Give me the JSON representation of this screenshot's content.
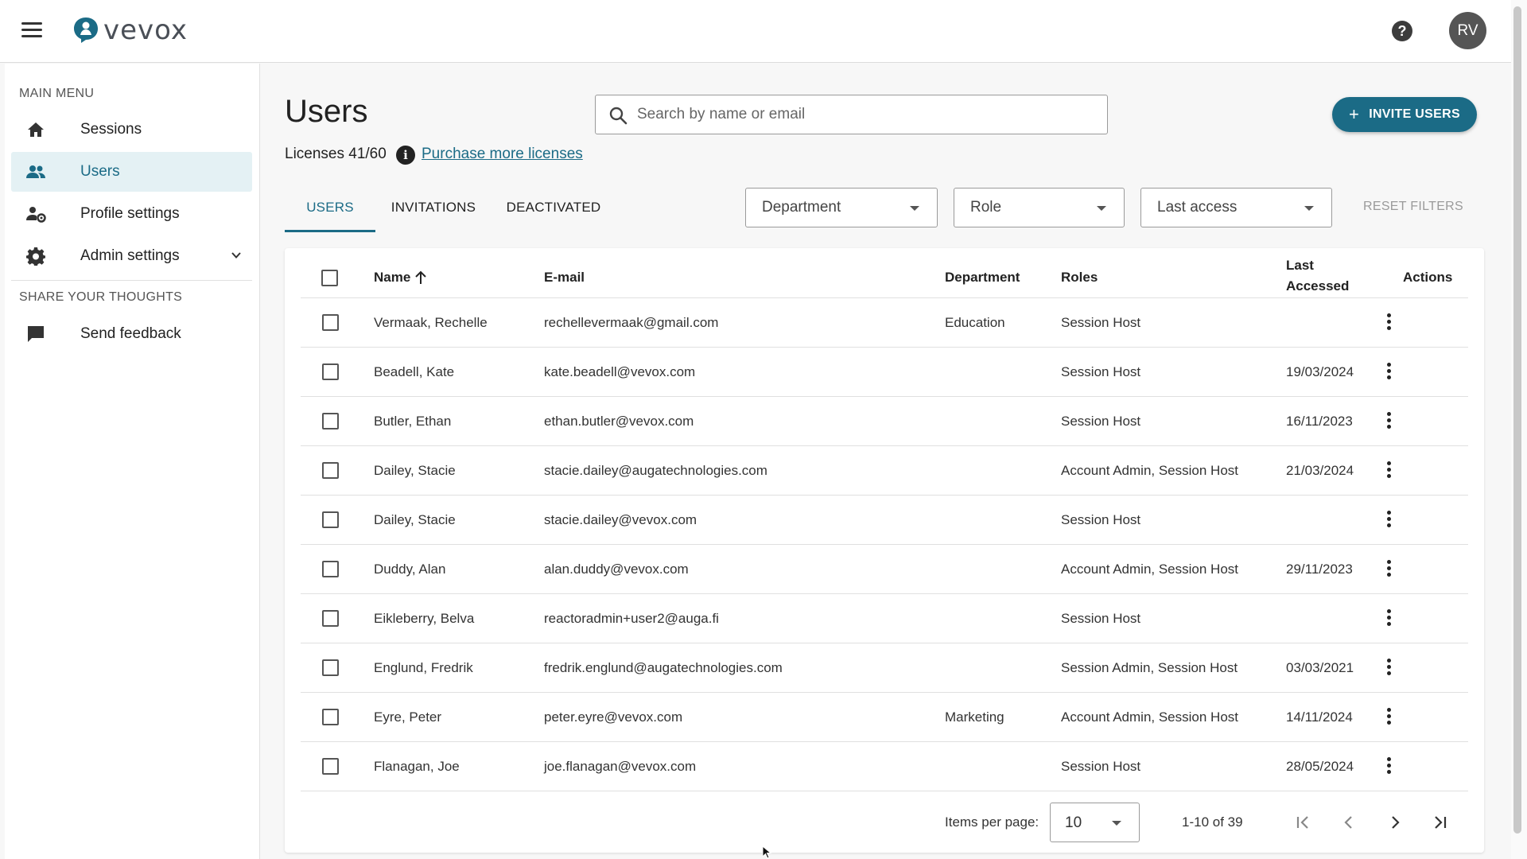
{
  "app": {
    "logo_text": "vevox",
    "avatar_initials": "RV",
    "accent_color": "#1b6b86"
  },
  "sidebar": {
    "main_menu_label": "MAIN MENU",
    "items": [
      {
        "label": "Sessions",
        "icon": "home-icon"
      },
      {
        "label": "Users",
        "icon": "users-icon",
        "active": true
      },
      {
        "label": "Profile settings",
        "icon": "profile-settings-icon"
      },
      {
        "label": "Admin settings",
        "icon": "gear-icon",
        "expandable": true
      }
    ],
    "share_label": "SHARE YOUR THOUGHTS",
    "feedback_label": "Send feedback"
  },
  "main": {
    "title": "Users",
    "licenses_text": "Licenses 41/60",
    "purchase_link": "Purchase more licenses",
    "search_placeholder": "Search by name or email",
    "invite_button": "INVITE USERS",
    "tabs": [
      "USERS",
      "INVITATIONS",
      "DEACTIVATED"
    ],
    "active_tab": "USERS",
    "filters": {
      "department": "Department",
      "role": "Role",
      "last_access": "Last access",
      "reset": "RESET FILTERS"
    }
  },
  "table": {
    "headers": {
      "name": "Name",
      "email": "E-mail",
      "department": "Department",
      "roles": "Roles",
      "last_accessed_1": "Last",
      "last_accessed_2": "Accessed",
      "actions": "Actions"
    },
    "rows": [
      {
        "name": "Vermaak, Rechelle",
        "email": "rechellevermaak@gmail.com",
        "department": "Education",
        "roles": "Session Host",
        "last": ""
      },
      {
        "name": "Beadell, Kate",
        "email": "kate.beadell@vevox.com",
        "department": "",
        "roles": "Session Host",
        "last": "19/03/2024"
      },
      {
        "name": "Butler, Ethan",
        "email": "ethan.butler@vevox.com",
        "department": "",
        "roles": "Session Host",
        "last": "16/11/2023"
      },
      {
        "name": "Dailey, Stacie",
        "email": "stacie.dailey@augatechnologies.com",
        "department": "",
        "roles": "Account Admin, Session Host",
        "last": "21/03/2024"
      },
      {
        "name": "Dailey, Stacie",
        "email": "stacie.dailey@vevox.com",
        "department": "",
        "roles": "Session Host",
        "last": ""
      },
      {
        "name": "Duddy, Alan",
        "email": "alan.duddy@vevox.com",
        "department": "",
        "roles": "Account Admin, Session Host",
        "last": "29/11/2023"
      },
      {
        "name": "Eikleberry, Belva",
        "email": "reactoradmin+user2@auga.fi",
        "department": "",
        "roles": "Session Host",
        "last": ""
      },
      {
        "name": "Englund, Fredrik",
        "email": "fredrik.englund@augatechnologies.com",
        "department": "",
        "roles": "Session Admin, Session Host",
        "last": "03/03/2021"
      },
      {
        "name": "Eyre, Peter",
        "email": "peter.eyre@vevox.com",
        "department": "Marketing",
        "roles": "Account Admin, Session Host",
        "last": "14/11/2024"
      },
      {
        "name": "Flanagan, Joe",
        "email": "joe.flanagan@vevox.com",
        "department": "",
        "roles": "Session Host",
        "last": "28/05/2024"
      }
    ]
  },
  "pagination": {
    "items_per_page_label": "Items per page:",
    "items_per_page": "10",
    "range": "1-10 of 39"
  }
}
